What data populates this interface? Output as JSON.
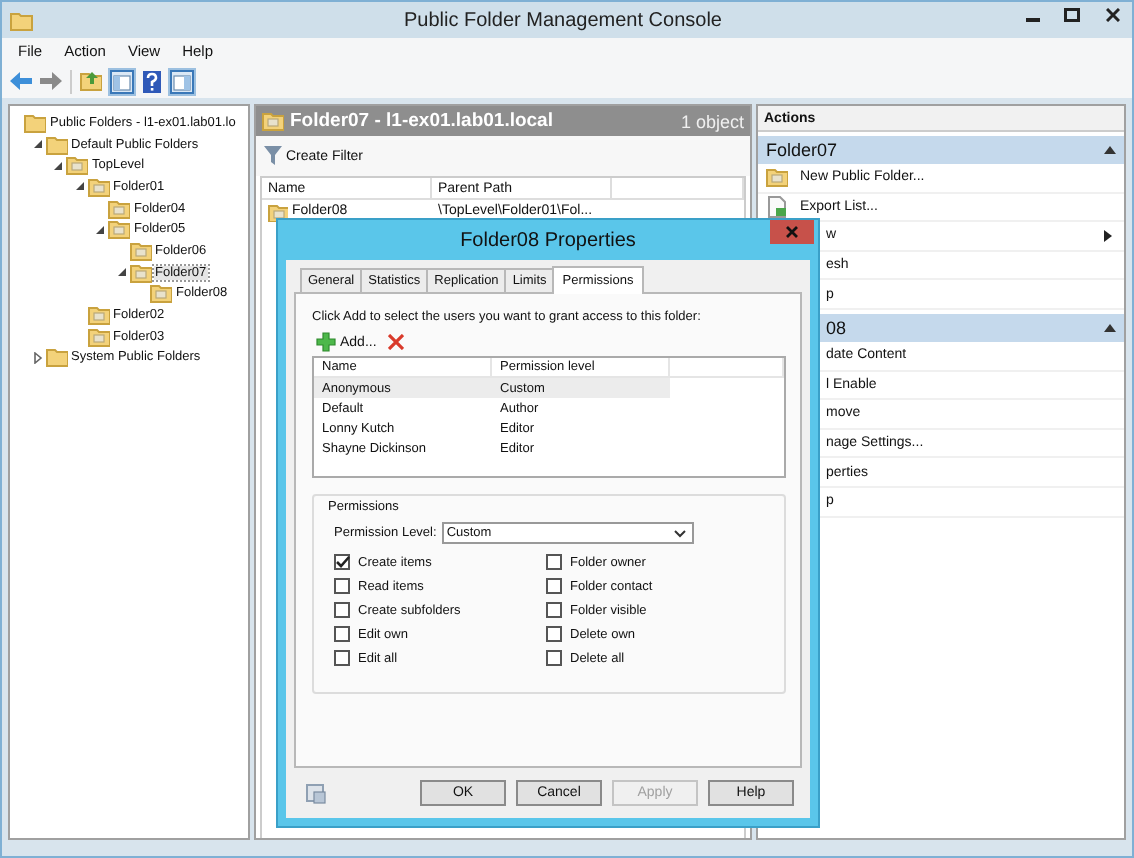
{
  "window": {
    "title": "Public Folder Management Console"
  },
  "menu": [
    "File",
    "Action",
    "View",
    "Help"
  ],
  "tree": [
    {
      "label": "Public Folders - l1-ex01.lab01.lo",
      "selected": false,
      "children": [
        {
          "label": "Default Public Folders",
          "expanded": true,
          "selected": false,
          "children": [
            {
              "label": "TopLevel",
              "expanded": true,
              "selected": false,
              "children": [
                {
                  "label": "Folder01",
                  "expanded": true,
                  "selected": false,
                  "children": [
                    {
                      "label": "Folder04",
                      "selected": false
                    },
                    {
                      "label": "Folder05",
                      "expanded": true,
                      "selected": false,
                      "children": [
                        {
                          "label": "Folder06",
                          "selected": false
                        },
                        {
                          "label": "Folder07",
                          "expanded": true,
                          "selected": true,
                          "children": [
                            {
                              "label": "Folder08",
                              "selected": false
                            }
                          ]
                        }
                      ]
                    }
                  ]
                },
                {
                  "label": "Folder02",
                  "selected": false
                },
                {
                  "label": "Folder03",
                  "selected": false
                }
              ]
            }
          ]
        },
        {
          "label": "System Public Folders",
          "expanded": false,
          "selected": false
        }
      ]
    }
  ],
  "content": {
    "title": "Folder07 - l1-ex01.lab01.local",
    "count": "1 object",
    "toolbar": [
      "Create Filter"
    ],
    "columns": [
      "Name",
      "Parent Path"
    ],
    "rows": [
      {
        "cells": [
          "Folder08",
          "\\TopLevel\\Folder01\\Fol..."
        ]
      }
    ]
  },
  "actions": {
    "title": "Actions",
    "sections": [
      {
        "title": "Folder07",
        "kind": "full",
        "items": [
          {
            "label": "New Public Folder...",
            "kind": "full",
            "submenu": false
          },
          {
            "label": "Export List...",
            "kind": "full",
            "submenu": false
          },
          {
            "label": "w",
            "kind": "partial",
            "submenu": true
          },
          {
            "label": "esh",
            "kind": "partial",
            "submenu": false
          },
          {
            "label": "p",
            "kind": "partial",
            "submenu": false
          }
        ]
      },
      {
        "title": "08",
        "kind": "partial",
        "items": [
          {
            "label": "date Content",
            "kind": "partial",
            "submenu": false
          },
          {
            "label": "l Enable",
            "kind": "partial",
            "submenu": false
          },
          {
            "label": "move",
            "kind": "partial",
            "submenu": false
          },
          {
            "label": "nage Settings...",
            "kind": "partial",
            "submenu": false
          },
          {
            "label": "perties",
            "kind": "partial",
            "submenu": false
          },
          {
            "label": "p",
            "kind": "partial",
            "submenu": false
          }
        ]
      }
    ]
  },
  "dialog": {
    "title": "Folder08 Properties",
    "tabs": [
      {
        "label": "General",
        "selected": false
      },
      {
        "label": "Statistics",
        "selected": false
      },
      {
        "label": "Replication",
        "selected": false
      },
      {
        "label": "Limits",
        "selected": false
      },
      {
        "label": "Permissions",
        "selected": true
      }
    ],
    "instructions": "Click Add to select the users you want to grant access to this folder:",
    "add_button": "Add...",
    "columns": [
      "Name",
      "Permission level"
    ],
    "rows": [
      {
        "name": "Anonymous",
        "permission": "Custom",
        "selected": true
      },
      {
        "name": "Default",
        "permission": "Author",
        "selected": false
      },
      {
        "name": "Lonny Kutch",
        "permission": "Editor",
        "selected": false
      },
      {
        "name": "Shayne Dickinson",
        "permission": "Editor",
        "selected": false
      }
    ],
    "group_title": "Permissions",
    "permission_level_label": "Permission Level:",
    "permission_level_value": "Custom",
    "checkboxes": [
      {
        "label": "Create items",
        "checked": true
      },
      {
        "label": "Folder owner",
        "checked": false
      },
      {
        "label": "Read items",
        "checked": false
      },
      {
        "label": "Folder contact",
        "checked": false
      },
      {
        "label": "Create subfolders",
        "checked": false
      },
      {
        "label": "Folder visible",
        "checked": false
      },
      {
        "label": "Edit own",
        "checked": false
      },
      {
        "label": "Delete own",
        "checked": false
      },
      {
        "label": "Edit all",
        "checked": false
      },
      {
        "label": "Delete all",
        "checked": false
      }
    ],
    "buttons": [
      {
        "label": "OK",
        "disabled": false
      },
      {
        "label": "Cancel",
        "disabled": false
      },
      {
        "label": "Apply",
        "disabled": true
      },
      {
        "label": "Help",
        "disabled": false
      }
    ]
  }
}
